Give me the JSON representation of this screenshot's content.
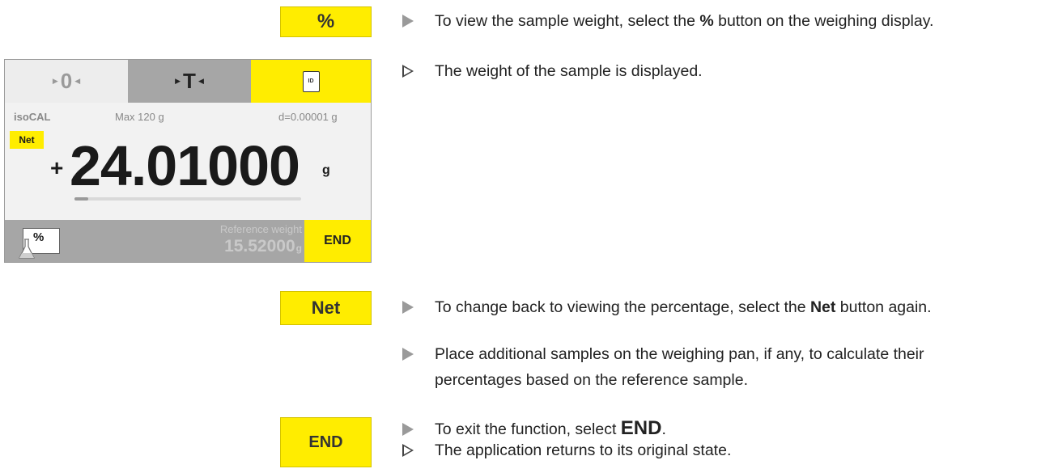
{
  "side_buttons": {
    "percent": "%",
    "net": "Net",
    "end": "END"
  },
  "display": {
    "zero_key": "0",
    "tare_key": "T",
    "id_icon_text": "ID",
    "program": "isoCAL",
    "max": "Max 120 g",
    "readability": "d=0.00001 g",
    "net_badge": "Net",
    "sign": "+",
    "weight": "24.01000",
    "unit": "g",
    "percent_key": "%",
    "reference_label": "Reference weight",
    "reference_value": "15.52000",
    "reference_unit": "g",
    "end_key": "END",
    "capacity_fill_fraction": 0.06
  },
  "steps": {
    "s1": {
      "before": "To view the sample weight, select the ",
      "bold": "%",
      "after": " button on the weighing display."
    },
    "s2": {
      "text": "The weight of the sample is displayed."
    },
    "s3": {
      "before": "To change back to viewing the percentage, select the ",
      "bold": "Net",
      "after": " button again."
    },
    "s4": {
      "line1": "Place additional samples on the weighing pan, if any, to calculate their",
      "line2": "percentages based on the reference sample."
    },
    "s5": {
      "before": "To exit the function, select ",
      "bold": "END",
      "after": "."
    },
    "s6": {
      "text": "The application returns to its original state."
    }
  }
}
